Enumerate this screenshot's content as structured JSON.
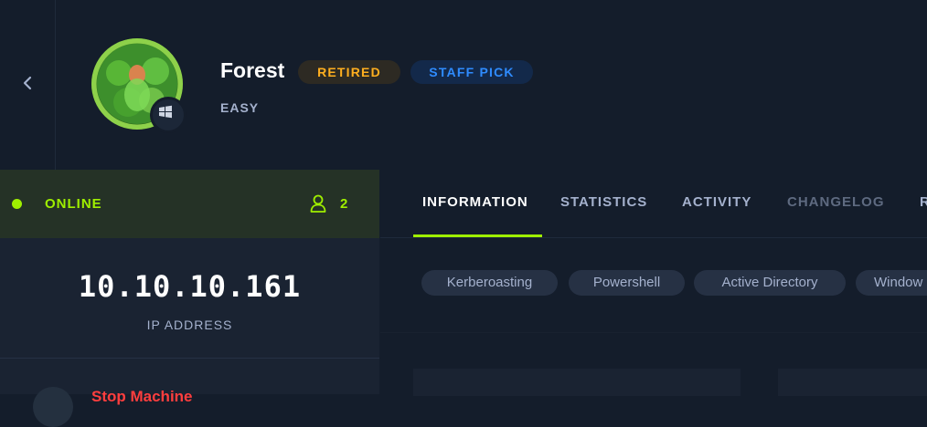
{
  "machine": {
    "name": "Forest",
    "difficulty": "EASY",
    "badges": {
      "retired": "RETIRED",
      "staff_pick": "STAFF PICK"
    },
    "os_icon": "windows-icon"
  },
  "status": {
    "label": "ONLINE",
    "players": "2",
    "icon": "user-icon"
  },
  "ip": {
    "value": "10.10.10.161",
    "label": "IP ADDRESS"
  },
  "actions": {
    "stop_label": "Stop Machine"
  },
  "tabs": [
    {
      "label": "INFORMATION"
    },
    {
      "label": "STATISTICS"
    },
    {
      "label": "ACTIVITY"
    },
    {
      "label": "CHANGELOG"
    },
    {
      "label": "R"
    }
  ],
  "tags": [
    {
      "label": "Kerberoasting"
    },
    {
      "label": "Powershell"
    },
    {
      "label": "Active Directory"
    },
    {
      "label": "Window"
    }
  ],
  "colors": {
    "accent": "#9fef00",
    "retired": "#ffaf1f",
    "staff_pick": "#2f8cff",
    "stop": "#ff3e3e"
  }
}
